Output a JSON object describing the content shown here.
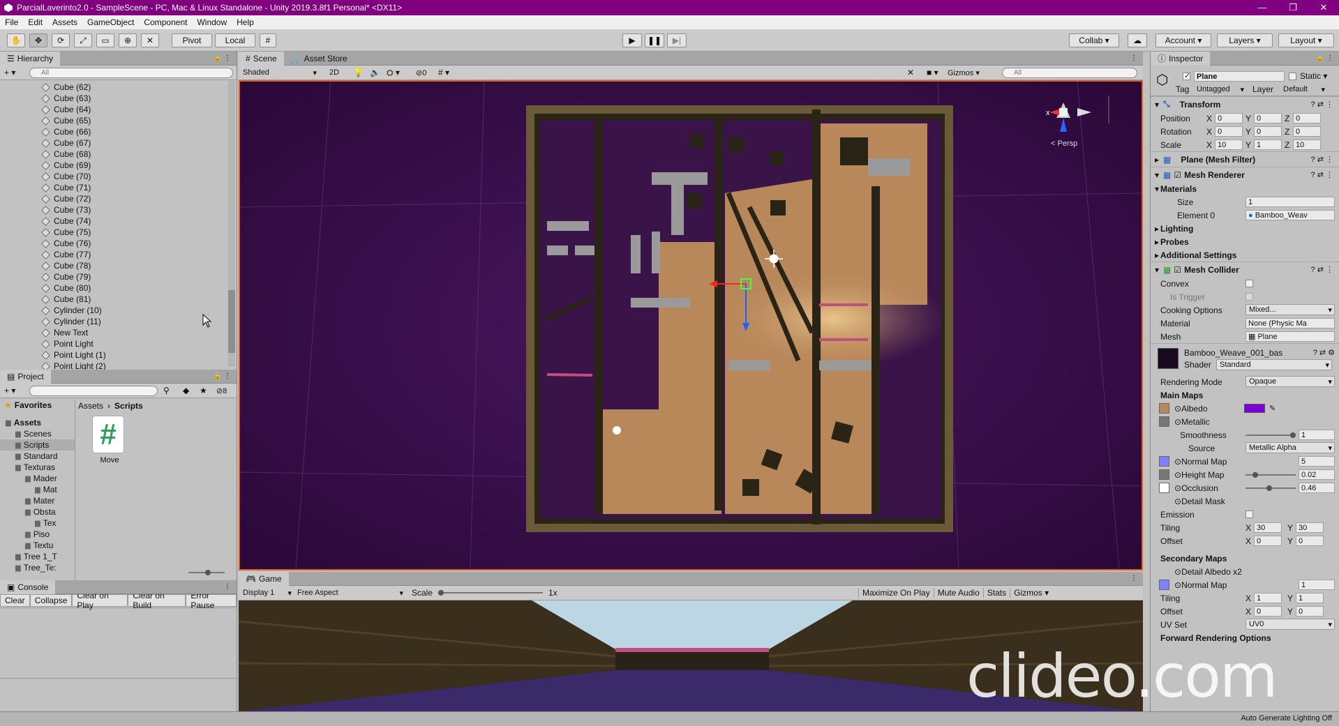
{
  "window": {
    "title": "ParcialLaverinto2.0 - SampleScene - PC, Mac & Linux Standalone - Unity 2019.3.8f1 Personal* <DX11>",
    "minimize": "—",
    "maximize": "❐",
    "close": "✕"
  },
  "menu": [
    "File",
    "Edit",
    "Assets",
    "GameObject",
    "Component",
    "Window",
    "Help"
  ],
  "toolbar": {
    "pivot": "Pivot",
    "local": "Local",
    "collab": "Collab",
    "account": "Account",
    "layers": "Layers",
    "layout": "Layout"
  },
  "hierarchy": {
    "tab": "Hierarchy",
    "search_placeholder": "All",
    "items": [
      "Cube (62)",
      "Cube (63)",
      "Cube (64)",
      "Cube (65)",
      "Cube (66)",
      "Cube (67)",
      "Cube (68)",
      "Cube (69)",
      "Cube (70)",
      "Cube (71)",
      "Cube (72)",
      "Cube (73)",
      "Cube (74)",
      "Cube (75)",
      "Cube (76)",
      "Cube (77)",
      "Cube (78)",
      "Cube (79)",
      "Cube (80)",
      "Cube (81)",
      "Cylinder (10)",
      "Cylinder (11)",
      "New Text",
      "Point Light",
      "Point Light (1)",
      "Point Light (2)"
    ]
  },
  "project": {
    "tab": "Project",
    "favorites": "Favorites",
    "badge": "8",
    "breadcrumb": [
      "Assets",
      "Scripts"
    ],
    "tree": [
      {
        "label": "Assets",
        "indent": 0
      },
      {
        "label": "Scenes",
        "indent": 1
      },
      {
        "label": "Scripts",
        "indent": 1
      },
      {
        "label": "Standard",
        "indent": 1
      },
      {
        "label": "Texturas",
        "indent": 1
      },
      {
        "label": "Mader",
        "indent": 2
      },
      {
        "label": "Mat",
        "indent": 3
      },
      {
        "label": "Mater",
        "indent": 2
      },
      {
        "label": "Obsta",
        "indent": 2
      },
      {
        "label": "Tex",
        "indent": 3
      },
      {
        "label": "Piso",
        "indent": 2
      },
      {
        "label": "Textu",
        "indent": 2
      },
      {
        "label": "Tree 1_T",
        "indent": 1
      },
      {
        "label": "Tree_Te:",
        "indent": 1
      }
    ],
    "file": {
      "icon": "#",
      "name": "Move"
    }
  },
  "console": {
    "tab": "Console",
    "buttons": [
      "Clear",
      "Collapse",
      "Clear on Play",
      "Clear on Build",
      "Error Pause"
    ]
  },
  "scene": {
    "tabs": [
      "Scene",
      "Asset Store"
    ],
    "shading": "Shaded",
    "mode2d": "2D",
    "fxcount": "0",
    "gizmos": "Gizmos",
    "search_placeholder": "All",
    "persp": "< Persp",
    "gizmo_x": "x"
  },
  "game": {
    "tab": "Game",
    "display": "Display 1",
    "aspect": "Free Aspect",
    "scale_label": "Scale",
    "scale_value": "1x",
    "buttons": [
      "Maximize On Play",
      "Mute Audio",
      "Stats",
      "Gizmos"
    ]
  },
  "inspector": {
    "tab": "Inspector",
    "name": "Plane",
    "static": "Static",
    "tag_label": "Tag",
    "tag": "Untagged",
    "layer_label": "Layer",
    "layer": "Default",
    "transform": {
      "title": "Transform",
      "rows": [
        {
          "label": "Position",
          "x": "0",
          "y": "0",
          "z": "0"
        },
        {
          "label": "Rotation",
          "x": "0",
          "y": "0",
          "z": "0"
        },
        {
          "label": "Scale",
          "x": "10",
          "y": "1",
          "z": "10"
        }
      ]
    },
    "mesh_filter": "Plane (Mesh Filter)",
    "mesh_renderer": "Mesh Renderer",
    "materials": {
      "title": "Materials",
      "size_label": "Size",
      "size": "1",
      "element_label": "Element 0",
      "element": "Bamboo_Weav"
    },
    "sections": [
      "Lighting",
      "Probes",
      "Additional Settings"
    ],
    "collider": {
      "title": "Mesh Collider",
      "convex": "Convex",
      "trigger": "Is Trigger",
      "cooking_label": "Cooking Options",
      "cooking": "Mixed...",
      "material_label": "Material",
      "material": "None (Physic Ma",
      "mesh_label": "Mesh",
      "mesh": "Plane"
    },
    "material": {
      "name": "Bamboo_Weave_001_bas",
      "shader_label": "Shader",
      "shader": "Standard",
      "rendering_label": "Rendering Mode",
      "rendering": "Opaque",
      "main_maps": "Main Maps",
      "albedo": "Albedo",
      "metallic": "Metallic",
      "smoothness_label": "Smoothness",
      "smoothness": "1",
      "source_label": "Source",
      "source": "Metallic Alpha",
      "normal": "Normal Map",
      "normal_val": "5",
      "height": "Height Map",
      "height_val": "0.02",
      "occlusion": "Occlusion",
      "occlusion_val": "0.46",
      "detail_mask": "Detail Mask",
      "emission": "Emission",
      "tiling_label": "Tiling",
      "tiling_x": "30",
      "tiling_y": "30",
      "offset_label": "Offset",
      "offset_x": "0",
      "offset_y": "0",
      "secondary": "Secondary Maps",
      "detail_albedo": "Detail Albedo x2",
      "normal2": "Normal Map",
      "normal2_val": "1",
      "tiling2_label": "Tiling",
      "tiling2_x": "1",
      "tiling2_y": "1",
      "offset2_label": "Offset",
      "offset2_x": "0",
      "offset2_y": "0",
      "uvset_label": "UV Set",
      "uvset": "UV0",
      "forward": "Forward Rendering Options"
    },
    "colors": {
      "albedo": "#7a00d6",
      "normal": "#8080ff"
    }
  },
  "watermark": "clideo.com",
  "status": "Auto Generate Lighting Off"
}
